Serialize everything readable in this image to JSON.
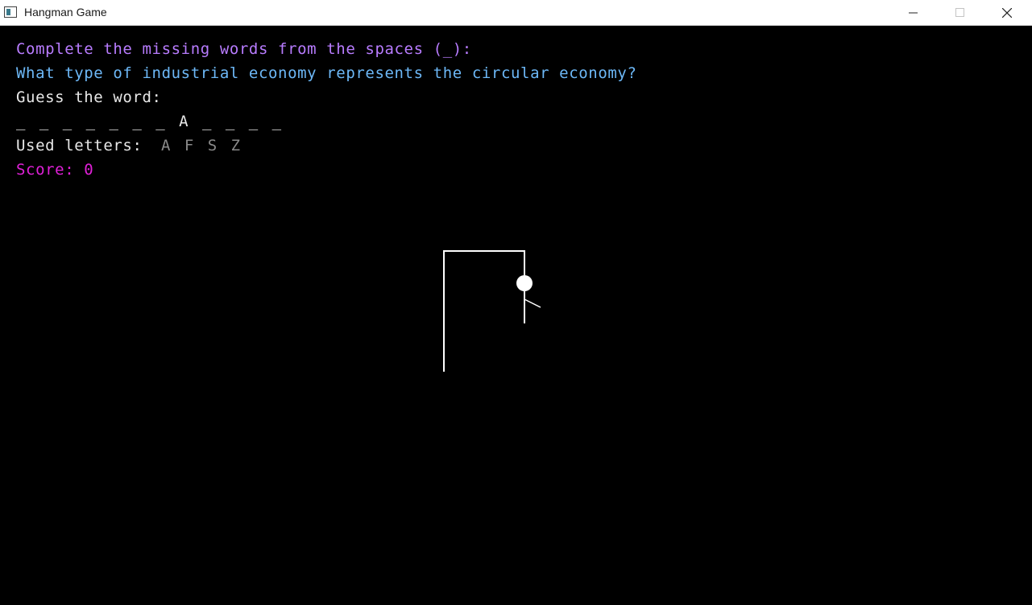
{
  "window": {
    "title": "Hangman Game",
    "icon": "app-window-icon",
    "controls": [
      "minimize-icon",
      "maximize-icon",
      "close-icon"
    ]
  },
  "game": {
    "instruction": "Complete the missing words from the spaces (_):",
    "question": "What type of industrial economy represents the circular economy?",
    "guess_prompt": "Guess the word:",
    "word_display": "_ _ _ _ _ _ _ A _ _ _ _",
    "used_letters_label": "Used letters:",
    "used_letters": "A F S Z",
    "score_label": "Score:",
    "score_value": "0"
  },
  "colors": {
    "background": "#000000",
    "instruction": "#b87cff",
    "question": "#6db8f7",
    "text": "#e8e8e8",
    "used_letters": "#8a8a8a",
    "score": "#e020d8",
    "drawing": "#ffffff"
  },
  "hangman": {
    "parts_drawn": [
      "post",
      "beam",
      "rope",
      "head",
      "body",
      "arm"
    ]
  }
}
